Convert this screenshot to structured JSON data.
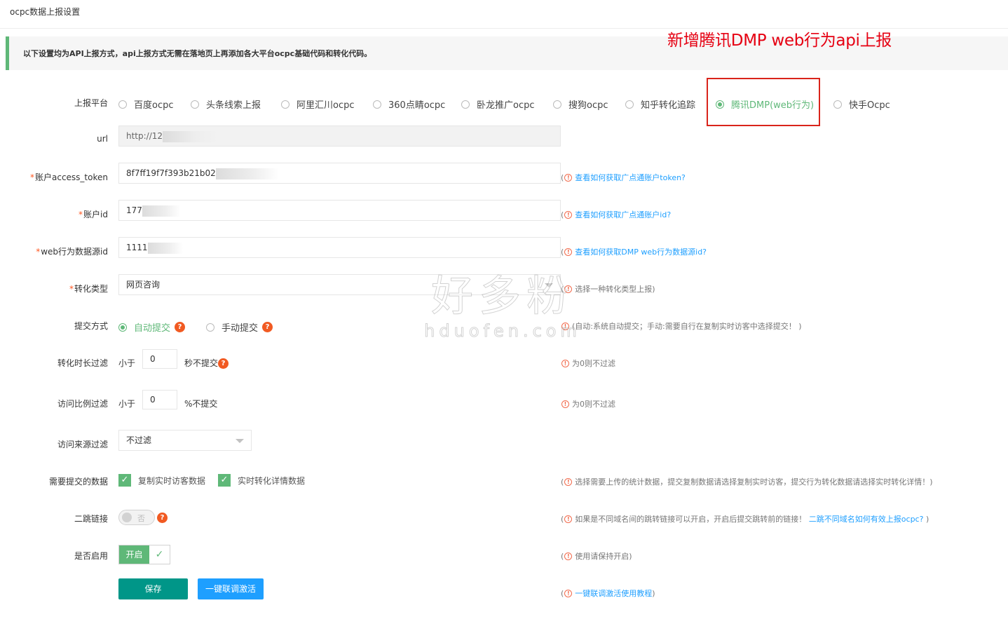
{
  "page": {
    "title": "ocpc数据上报设置",
    "notice": "以下设置均为API上报方式，api上报方式无需在落地页上再添加各大平台ocpc基础代码和转化代码。",
    "annotation": "新增腾讯DMP web行为api上报"
  },
  "platform": {
    "label": "上报平台",
    "options": [
      "百度ocpc",
      "头条线索上报",
      "阿里汇川ocpc",
      "360点睛ocpc",
      "卧龙推广ocpc",
      "搜狗ocpc",
      "知乎转化追踪",
      "腾讯DMP(web行为)",
      "快手Ocpc"
    ],
    "selected": "腾讯DMP(web行为)"
  },
  "url": {
    "label": "url",
    "value": "http://12"
  },
  "access_token": {
    "label": "账户access_token",
    "value": "8f7ff19f7f393b21b02",
    "help": "查看如何获取广点通账户token?"
  },
  "account_id": {
    "label": "账户id",
    "value": "177",
    "help": "查看如何获取广点通账户id?"
  },
  "web_source_id": {
    "label": "web行为数据源id",
    "value": "1111",
    "help": "查看如何获取DMP web行为数据源id?"
  },
  "conversion_type": {
    "label": "转化类型",
    "value": "网页咨询",
    "help": "选择一种转化类型上报)"
  },
  "submit_mode": {
    "label": "提交方式",
    "options": [
      "自动提交",
      "手动提交"
    ],
    "selected": "自动提交",
    "help": "(自动:系统自动提交；手动:需要自行在复制实时访客中选择提交！ )"
  },
  "duration_filter": {
    "label": "转化时长过滤",
    "prefix": "小于",
    "value": "0",
    "suffix": "秒不提交",
    "help": "为0则不过滤"
  },
  "ratio_filter": {
    "label": "访问比例过滤",
    "prefix": "小于",
    "value": "0",
    "suffix": "%不提交",
    "help": "为0则不过滤"
  },
  "source_filter": {
    "label": "访问来源过滤",
    "value": "不过滤"
  },
  "data_to_submit": {
    "label": "需要提交的数据",
    "options": [
      "复制实时访客数据",
      "实时转化详情数据"
    ],
    "help": "选择需要上传的统计数据，提交复制数据请选择复制实时访客，提交行为转化数据请选择实时转化详情！)"
  },
  "redirect_link": {
    "label": "二跳链接",
    "toggle_text": "否",
    "help": "如果是不同域名间的跳转链接可以开启，开启后提交跳转前的链接！",
    "help_link": "二跳不同域名如何有效上报ocpc?",
    "help_tail": ")"
  },
  "enabled": {
    "label": "是否启用",
    "value": "开启",
    "help": "使用请保持开启)"
  },
  "buttons": {
    "save": "保存",
    "test": "一键联调激活",
    "test_help": "一键联调激活使用教程"
  },
  "watermark": {
    "cn": "好多粉",
    "en": "hduofen.com"
  },
  "colors": {
    "green": "#5fb878",
    "teal": "#009688",
    "blue": "#1e9fff",
    "red": "#e60012",
    "orange": "#f15a22"
  }
}
